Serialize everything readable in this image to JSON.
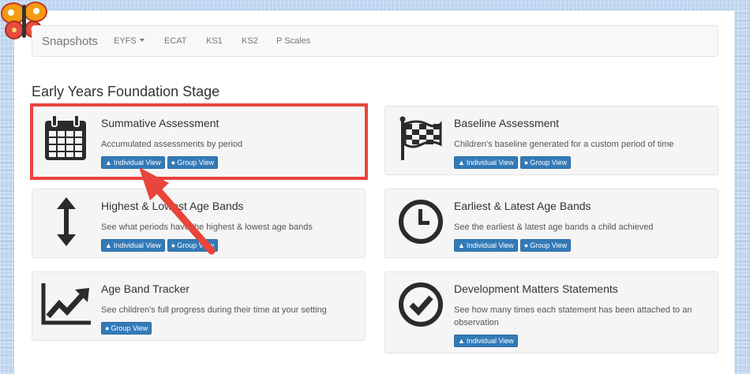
{
  "navbar": {
    "brand": "Snapshots",
    "items": [
      {
        "label": "EYFS",
        "dropdown": true
      },
      {
        "label": "ECAT"
      },
      {
        "label": "KS1"
      },
      {
        "label": "KS2"
      },
      {
        "label": "P Scales"
      }
    ]
  },
  "section_title": "Early Years Foundation Stage",
  "buttons": {
    "individual_view": "Individual View",
    "group_view": "Group View"
  },
  "cards": [
    {
      "title": "Summative Assessment",
      "description": "Accumulated assessments by period",
      "icon": "calendar-icon",
      "buttons": [
        "Individual View",
        "Group View"
      ]
    },
    {
      "title": "Baseline Assessment",
      "description": "Children's baseline generated for a custom period of time",
      "icon": "checkered-flag-icon",
      "buttons": [
        "Individual View",
        "Group View"
      ]
    },
    {
      "title": "Highest & Lowest Age Bands",
      "description": "See what periods have the highest & lowest age bands",
      "icon": "vertical-arrows-icon",
      "buttons": [
        "Individual View",
        "Group View"
      ]
    },
    {
      "title": "Earliest & Latest Age Bands",
      "description": "See the earliest & latest age bands a child achieved",
      "icon": "clock-icon",
      "buttons": [
        "Individual View",
        "Group View"
      ]
    },
    {
      "title": "Age Band Tracker",
      "description": "See children's full progress during their time at your setting",
      "icon": "trending-up-chart-icon",
      "buttons": [
        "Group View"
      ]
    },
    {
      "title": "Development Matters Statements",
      "description": "See how many times each statement has been attached to an observation",
      "icon": "check-circle-icon",
      "buttons": [
        "Individual View"
      ]
    }
  ],
  "colors": {
    "button": "#337ab7",
    "highlight": "#e8453c",
    "background": "#bcd4ef"
  }
}
